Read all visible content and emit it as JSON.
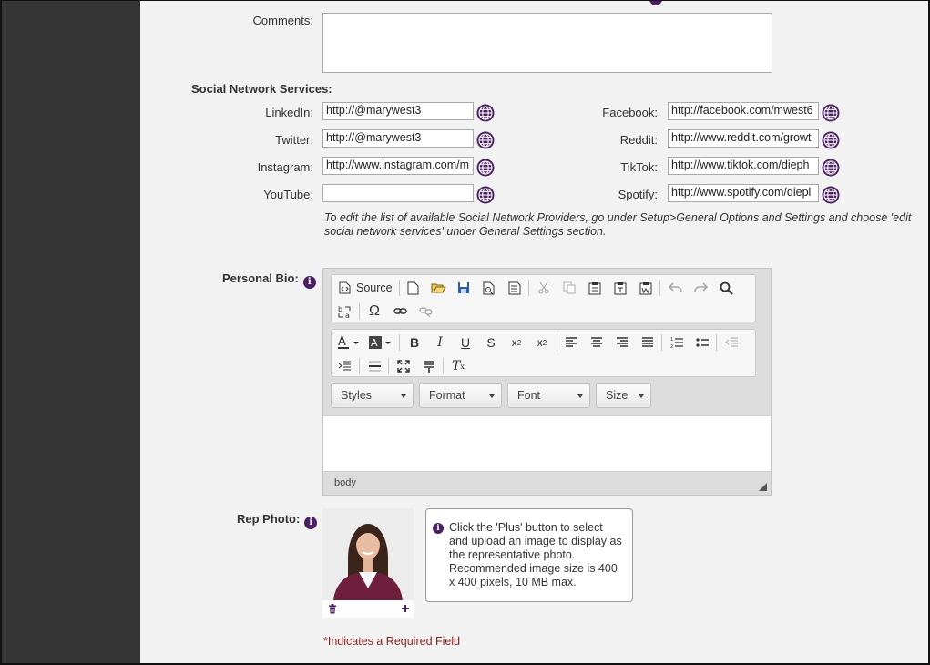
{
  "comments": {
    "label": "Comments:",
    "value": ""
  },
  "social": {
    "heading": "Social Network Services:",
    "left": [
      {
        "label": "LinkedIn:",
        "value": "http://@marywest3"
      },
      {
        "label": "Twitter:",
        "value": "http://@marywest3"
      },
      {
        "label": "Instagram:",
        "value": "http://www.instagram.com/m"
      },
      {
        "label": "YouTube:",
        "value": ""
      }
    ],
    "right": [
      {
        "label": "Facebook:",
        "value": "http://facebook.com/mwest6"
      },
      {
        "label": "Reddit:",
        "value": "http://www.reddit.com/growt"
      },
      {
        "label": "TikTok:",
        "value": "http://www.tiktok.com/dieph"
      },
      {
        "label": "Spotify:",
        "value": "http://www.spotify.com/diepl"
      }
    ],
    "note": "To edit the list of available Social Network Providers, go under Setup>General Options and Settings and choose 'edit social network services' under General Settings section."
  },
  "bio": {
    "label": "Personal Bio:",
    "source_label": "Source",
    "combos": {
      "styles": "Styles",
      "format": "Format",
      "font": "Font",
      "size": "Size"
    },
    "path": "body"
  },
  "photo": {
    "label": "Rep Photo:",
    "tip": "Click the 'Plus' button to select and upload an image to display as the representative photo. Recommended image size is 400 x 400 pixels, 10 MB max."
  },
  "required_note": "*Indicates a Required Field",
  "colors": {
    "accent": "#4b1f63",
    "sidebar": "#353535",
    "required": "#8a1f1f"
  }
}
